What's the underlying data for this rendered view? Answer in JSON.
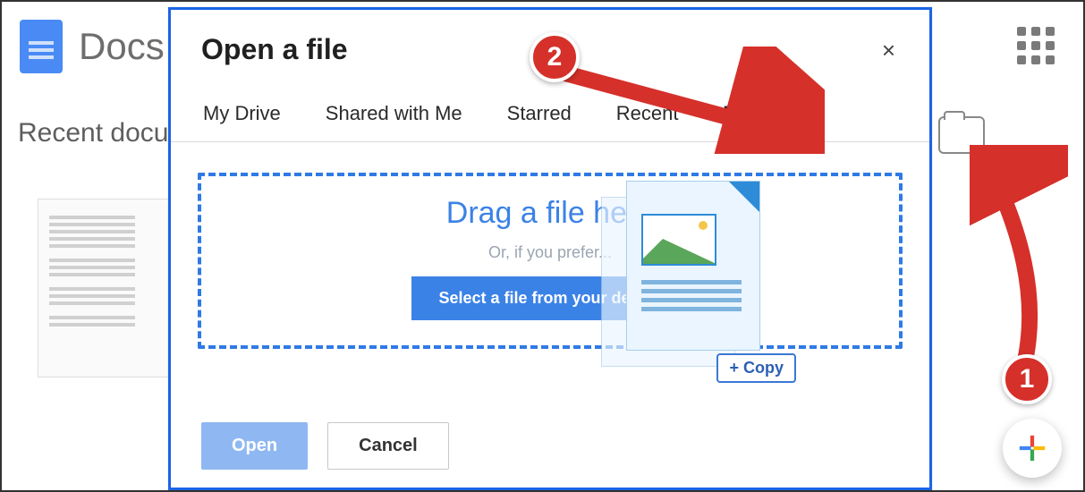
{
  "app": {
    "name": "Docs",
    "recent_label": "Recent documents"
  },
  "modal": {
    "title": "Open a file",
    "close_label": "×",
    "tabs": {
      "my_drive": "My Drive",
      "shared": "Shared with Me",
      "starred": "Starred",
      "recent": "Recent",
      "upload": "Upload"
    },
    "dropzone": {
      "title": "Drag a file here",
      "subtitle": "Or, if you prefer...",
      "select_button": "Select a file from your device"
    },
    "actions": {
      "open": "Open",
      "cancel": "Cancel"
    },
    "drag_hint": "Copy"
  },
  "annotations": {
    "step1": "1",
    "step2": "2"
  }
}
